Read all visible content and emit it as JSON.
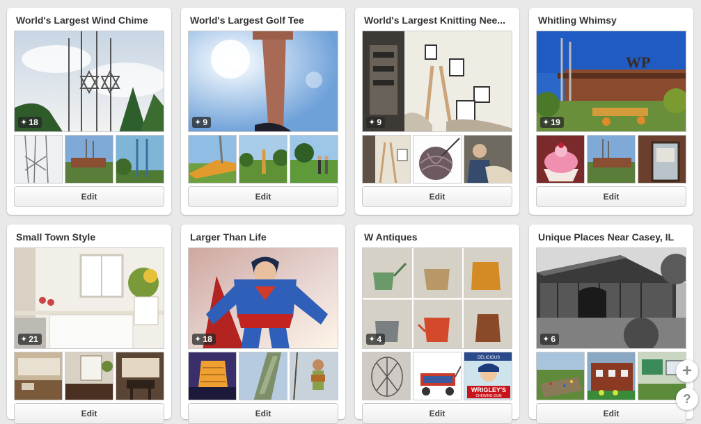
{
  "boards": [
    {
      "title": "World's Largest Wind Chime",
      "pin_count": "18",
      "edit_label": "Edit"
    },
    {
      "title": "World's Largest Golf Tee",
      "pin_count": "9",
      "edit_label": "Edit"
    },
    {
      "title": "World's Largest Knitting Nee...",
      "pin_count": "9",
      "edit_label": "Edit"
    },
    {
      "title": "Whitling Whimsy",
      "pin_count": "19",
      "edit_label": "Edit"
    },
    {
      "title": "Small Town Style",
      "pin_count": "21",
      "edit_label": "Edit"
    },
    {
      "title": "Larger Than Life",
      "pin_count": "18",
      "edit_label": "Edit"
    },
    {
      "title": "W Antiques",
      "pin_count": "4",
      "edit_label": "Edit"
    },
    {
      "title": "Unique Places Near Casey, IL",
      "pin_count": "6",
      "edit_label": "Edit"
    }
  ],
  "floating": {
    "add_symbol": "+",
    "help_symbol": "?"
  },
  "images": {
    "wrigleys_sign": "WRIGLEY'S",
    "wrigleys_sub": "CHEWING GUM",
    "delicious_sign": "DELICIOUS",
    "wp_sign": "WP"
  },
  "icons": {
    "pin": "pushpin-icon",
    "add": "plus-icon",
    "help": "question-icon"
  }
}
